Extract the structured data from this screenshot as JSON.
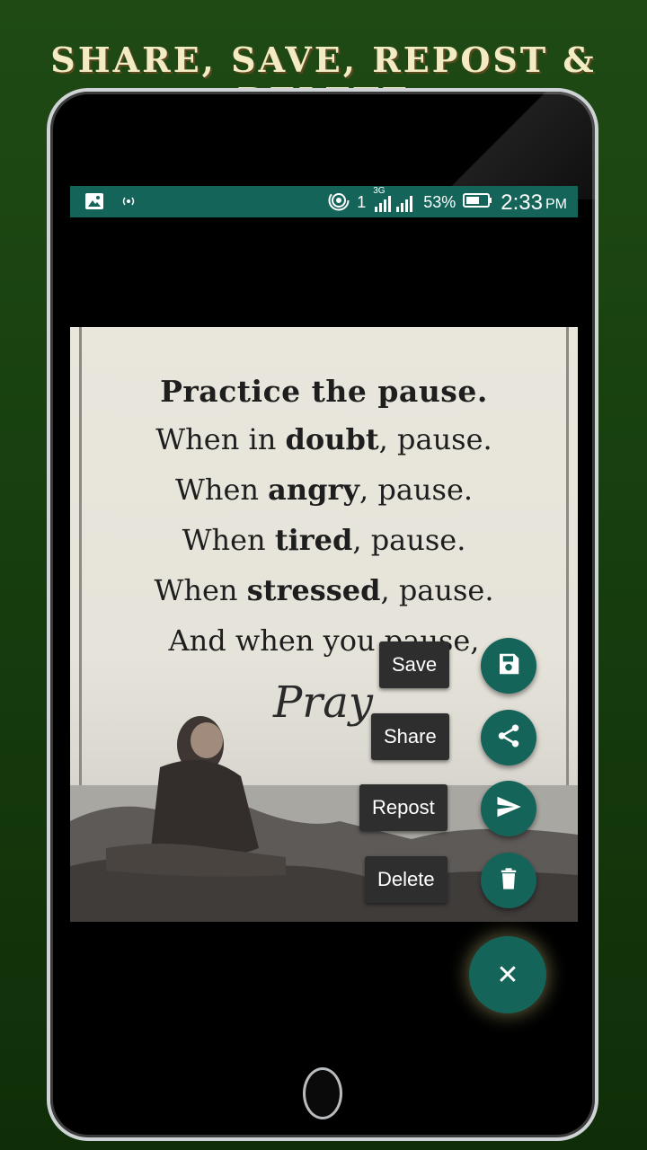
{
  "headline": "SHARE, SAVE, REPOST & DELETE",
  "status_bar": {
    "left_icons": [
      "image-icon",
      "hotspot-icon"
    ],
    "network": "1",
    "network_type": "3G",
    "battery": "53%",
    "time": "2:33",
    "ampm": "PM"
  },
  "quote_image": {
    "line1": "Practice  the pause.",
    "line2_a": "When in ",
    "line2_b": "doubt",
    "line2_c": ", pause.",
    "line3_a": "When ",
    "line3_b": "angry",
    "line3_c": ", pause.",
    "line4_a": "When ",
    "line4_b": "tired",
    "line4_c": ", pause.",
    "line5_a": "When ",
    "line5_b": "stressed",
    "line5_c": ", pause.",
    "line6": "And when you pause,",
    "signature": "Pray"
  },
  "fab_menu": {
    "save_label": "Save",
    "share_label": "Share",
    "repost_label": "Repost",
    "delete_label": "Delete",
    "close_symbol": "✕"
  },
  "colors": {
    "accent": "#15645a",
    "background": "#1f4a14",
    "headline": "#f3ebc4"
  }
}
